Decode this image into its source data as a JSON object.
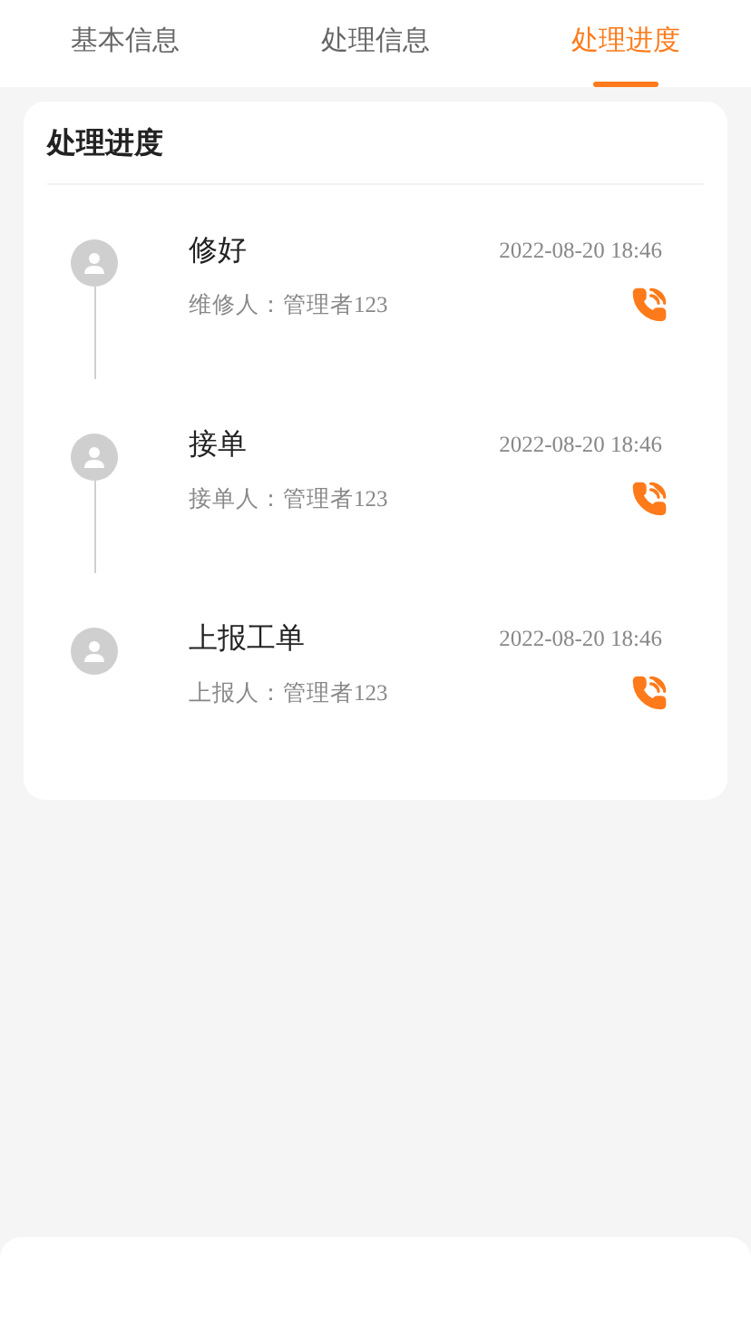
{
  "tabs": [
    {
      "label": "基本信息",
      "selected": false
    },
    {
      "label": "处理信息",
      "selected": false
    },
    {
      "label": "处理进度",
      "selected": true
    }
  ],
  "progress": {
    "title": "处理进度",
    "steps": [
      {
        "title": "修好",
        "time": "2022-08-20 18:46",
        "person": "维修人：管理者123"
      },
      {
        "title": "接单",
        "time": "2022-08-20 18:46",
        "person": "接单人：管理者123"
      },
      {
        "title": "上报工单",
        "time": "2022-08-20 18:46",
        "person": "上报人：管理者123"
      }
    ]
  }
}
